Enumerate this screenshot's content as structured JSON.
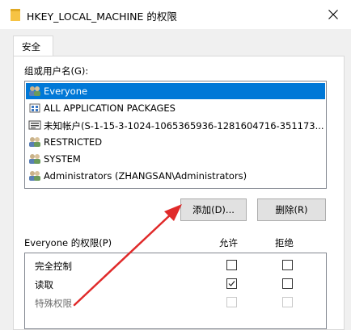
{
  "window": {
    "title": "HKEY_LOCAL_MACHINE 的权限",
    "folder_icon": "folder-icon",
    "close_icon": "close-icon"
  },
  "tabs": [
    {
      "label": "安全",
      "active": true
    }
  ],
  "group_section": {
    "label": "组或用户名(G):",
    "users": [
      {
        "name": "Everyone",
        "icon": "users-group-icon",
        "selected": true
      },
      {
        "name": "ALL APPLICATION PACKAGES",
        "icon": "package-icon",
        "selected": false
      },
      {
        "name": "未知帐户(S-1-15-3-1024-1065365936-1281604716-351173...",
        "icon": "unknown-account-icon",
        "selected": false
      },
      {
        "name": "RESTRICTED",
        "icon": "users-group-icon",
        "selected": false
      },
      {
        "name": "SYSTEM",
        "icon": "users-group-icon",
        "selected": false
      },
      {
        "name": "Administrators (ZHANGSAN\\Administrators)",
        "icon": "users-group-icon",
        "selected": false
      }
    ]
  },
  "buttons": {
    "add": "添加(D)...",
    "remove": "删除(R)"
  },
  "permissions": {
    "label": "Everyone 的权限(P)",
    "allow_header": "允许",
    "deny_header": "拒绝",
    "rows": [
      {
        "name": "完全控制",
        "allow": false,
        "deny": false,
        "enabled": true
      },
      {
        "name": "读取",
        "allow": true,
        "deny": false,
        "enabled": true
      },
      {
        "name": "特殊权限",
        "allow": false,
        "deny": false,
        "enabled": false
      }
    ]
  },
  "colors": {
    "selection": "#0078d7",
    "annotation_arrow": "#e02a2a",
    "folder": "#f6c344"
  }
}
